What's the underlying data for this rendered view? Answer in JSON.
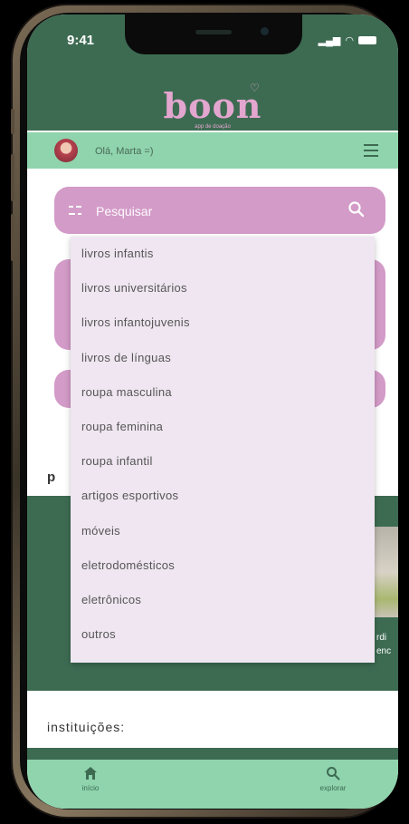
{
  "status_bar": {
    "time": "9:41"
  },
  "header": {
    "logo": "boon",
    "logo_subtitle": "app de doação"
  },
  "greeting": {
    "text": "Olá, Marta =)"
  },
  "search": {
    "placeholder": "Pesquisar",
    "suggestions": [
      "livros infantis",
      "livros universitários",
      "livros infantojuvenis",
      "livros de línguas",
      "roupa masculina",
      "roupa feminina",
      "roupa infantil",
      "artigos esportivos",
      "móveis",
      "eletrodomésticos",
      "eletrônicos",
      "outros"
    ]
  },
  "background": {
    "section_partial": "p",
    "photo_text_1": "rdi",
    "photo_text_2": "enc"
  },
  "institutions": {
    "title": "instituições:"
  },
  "bottom_nav": {
    "home_label": "início",
    "explore_label": "explorar"
  },
  "colors": {
    "header_green": "#3d6b52",
    "mint": "#8fd4ad",
    "pink": "#d39bc8",
    "dropdown_bg": "#efe6f1"
  }
}
